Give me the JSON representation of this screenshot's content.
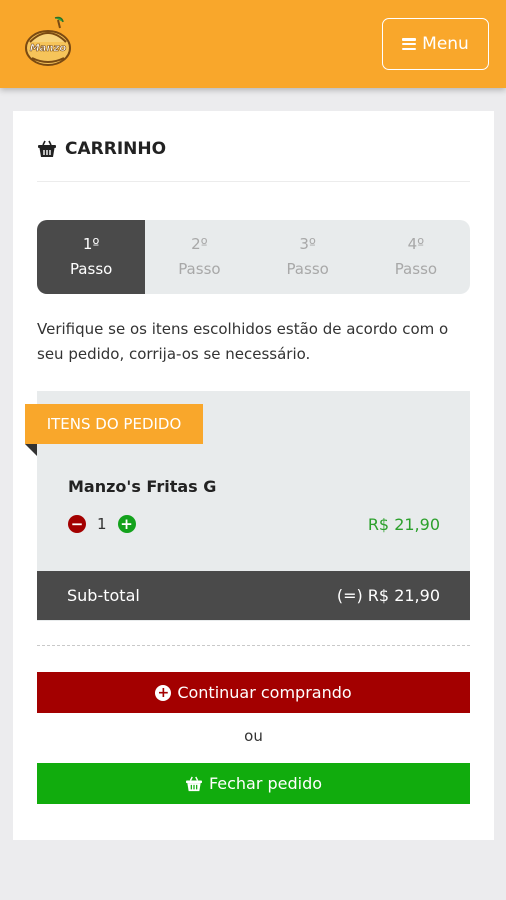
{
  "header": {
    "logo_name": "manzo-logo",
    "menu_label": "Menu"
  },
  "cart": {
    "title": "CARRINHO",
    "steps": [
      {
        "number": "1º",
        "label": "Passo",
        "active": true
      },
      {
        "number": "2º",
        "label": "Passo",
        "active": false
      },
      {
        "number": "3º",
        "label": "Passo",
        "active": false
      },
      {
        "number": "4º",
        "label": "Passo",
        "active": false
      }
    ],
    "intro": "Verifique se os itens escolhidos estão de acordo com o seu pedido, corrija-os se necessário.",
    "items_label": "ITENS DO PEDIDO",
    "items": [
      {
        "name": "Manzo's Fritas G",
        "quantity": "1",
        "price": "R$ 21,90"
      }
    ],
    "subtotal_label": "Sub-total",
    "subtotal_value": "(=) R$ 21,90",
    "continue_label": "Continuar comprando",
    "or_label": "ou",
    "close_label": "Fechar pedido"
  },
  "colors": {
    "brand_orange": "#f9a72b",
    "dark_gray": "#4a4a4a",
    "danger_red": "#a30000",
    "success_green": "#11ac0d",
    "price_green": "#2ca02c"
  },
  "icons": {
    "menu": "bars-icon",
    "cart": "basket-icon",
    "decrease": "minus-circle-icon",
    "increase": "plus-circle-icon",
    "continue": "plus-circle-icon",
    "close": "basket-icon"
  }
}
